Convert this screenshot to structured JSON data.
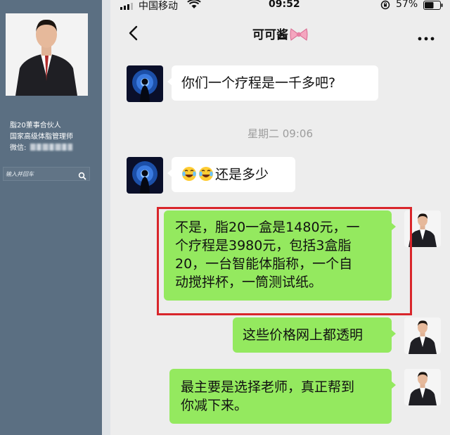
{
  "sidebar": {
    "name_lines": [
      "脂20董事合伙人",
      "国家高级体脂管理师"
    ],
    "wechat_label": "微信:",
    "search_placeholder": "输入并回车",
    "icons": {
      "search": "search-icon"
    }
  },
  "status_bar": {
    "carrier": "中国移动",
    "time": "09:52",
    "battery": "57%",
    "icons": [
      "signal-icon",
      "wifi-icon",
      "rotation-lock-icon",
      "battery-icon"
    ]
  },
  "chat": {
    "title": "可可酱",
    "title_icon": "pink-bow-icon",
    "back_icon": "back-arrow-icon",
    "more_icon": "more-icon",
    "timestamp": "星期二 09:06",
    "messages": [
      {
        "side": "left",
        "text": "你们一个疗程是一千多吧?"
      },
      {
        "side": "left",
        "emojis": [
          "tears-of-joy-emoji",
          "tears-of-joy-emoji"
        ],
        "text": "还是多少"
      },
      {
        "side": "right",
        "lines": [
          "不是，脂20一盒是1480元，一",
          "个疗程是3980元，包括3盒脂",
          "20，一台智能体脂称，一个自",
          "动搅拌杯，一筒测试纸。"
        ],
        "highlighted": true
      },
      {
        "side": "right",
        "text": "这些价格网上都透明"
      },
      {
        "side": "right",
        "lines": [
          "最主要是选择老师，真正帮到",
          "你减下来。"
        ]
      }
    ]
  },
  "colors": {
    "sidebar_bg": "#5b6f82",
    "chat_bg": "#ededed",
    "bubble_sent": "#94e95f",
    "bubble_received": "#ffffff",
    "highlight": "#d9262b"
  }
}
